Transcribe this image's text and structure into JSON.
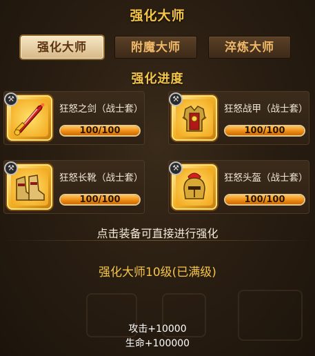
{
  "header": {
    "title": "强化大师"
  },
  "tabs": [
    {
      "label": "强化大师",
      "active": true
    },
    {
      "label": "附魔大师",
      "active": false
    },
    {
      "label": "淬炼大师",
      "active": false
    }
  ],
  "progress": {
    "title": "强化进度",
    "items": [
      {
        "name": "狂怒之剑（战士套）",
        "progress_text": "100/100",
        "progress": 1.0,
        "icon": "sword-icon"
      },
      {
        "name": "狂怒战甲（战士套）",
        "progress_text": "100/100",
        "progress": 1.0,
        "icon": "armor-icon"
      },
      {
        "name": "狂怒长靴（战士套）",
        "progress_text": "100/100",
        "progress": 1.0,
        "icon": "boots-icon"
      },
      {
        "name": "狂怒头盔（战士套）",
        "progress_text": "100/100",
        "progress": 1.0,
        "icon": "helmet-icon"
      }
    ]
  },
  "hint": "点击装备可直接进行强化",
  "level": "强化大师10级(已满级)",
  "stats": [
    "攻击+10000",
    "生命+100000"
  ],
  "colors": {
    "accent": "#f5c54a",
    "bar": "#ee8c12",
    "background": "#241a10"
  }
}
